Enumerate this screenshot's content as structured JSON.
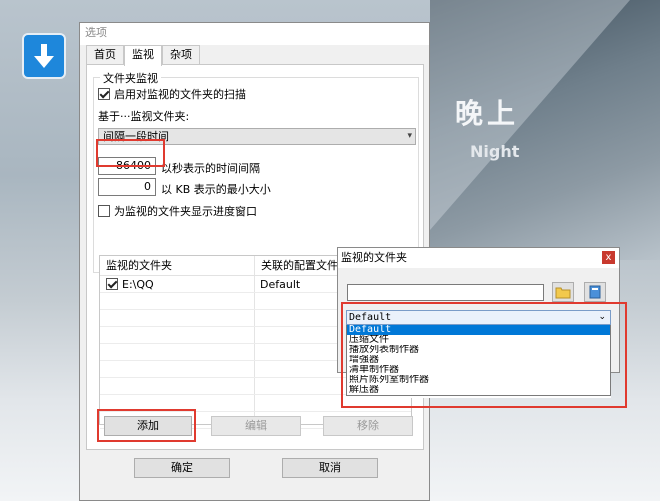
{
  "desktop": {
    "title": "晚上",
    "subtitle": "Night"
  },
  "window": {
    "title": "选项",
    "tabs": [
      {
        "label": "首页",
        "active": false
      },
      {
        "label": "监视",
        "active": true
      },
      {
        "label": "杂项",
        "active": false
      }
    ],
    "group_title": "文件夹监视",
    "enable_scan": {
      "label": "启用对监视的文件夹的扫描",
      "checked": true
    },
    "based_on_label": "基于···监视文件夹:",
    "mode_select": {
      "value": "间隔一段时间"
    },
    "interval": {
      "value": "86400",
      "label": "以秒表示的时间间隔"
    },
    "min_size": {
      "value": "0",
      "label": "以 KB 表示的最小大小"
    },
    "show_progress": {
      "label": "为监视的文件夹显示进度窗口",
      "checked": false
    },
    "list": {
      "headers": [
        "监视的文件夹",
        "关联的配置文件"
      ],
      "rows": [
        {
          "folder": "E:\\QQ",
          "profile": "Default",
          "checked": true
        }
      ]
    },
    "buttons": {
      "add": "添加",
      "edit": "编辑",
      "remove": "移除",
      "ok": "确定",
      "cancel": "取消"
    }
  },
  "popup": {
    "title": "监视的文件夹",
    "close": "x",
    "path_value": "",
    "dropdown": {
      "selected": "Default",
      "options": [
        "Default",
        "压缩文件",
        "播放列表制作器",
        "增强器",
        "清单制作器",
        "照片陈列室制作器",
        "解压器"
      ],
      "highlighted_index": 0
    }
  },
  "colors": {
    "highlight_box": "#e03a2f",
    "selection": "#0078d7"
  }
}
